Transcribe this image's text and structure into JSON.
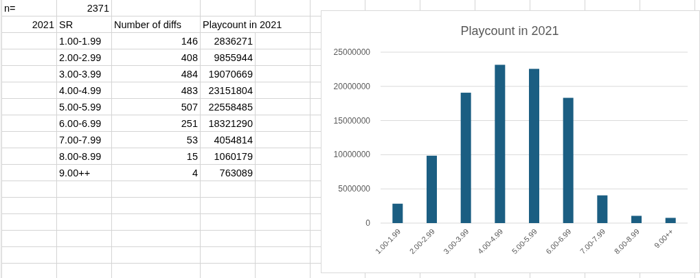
{
  "sheet": {
    "rows": [
      {
        "cells": [
          {
            "text": "n=",
            "kind": "text"
          },
          {
            "text": "2371",
            "kind": "number"
          }
        ]
      },
      {
        "cells": [
          {
            "text": "2021",
            "kind": "number"
          },
          {
            "text": "SR",
            "kind": "text"
          },
          {
            "text": "Number of diffs",
            "kind": "text"
          },
          {
            "text": "Playcount in 2021",
            "kind": "text"
          }
        ]
      },
      {
        "cells": [
          null,
          {
            "text": "1.00-1.99",
            "kind": "text"
          },
          {
            "text": "146",
            "kind": "number"
          },
          {
            "text": "2836271",
            "kind": "number"
          }
        ]
      },
      {
        "cells": [
          null,
          {
            "text": "2.00-2.99",
            "kind": "text"
          },
          {
            "text": "408",
            "kind": "number"
          },
          {
            "text": "9855944",
            "kind": "number"
          }
        ]
      },
      {
        "cells": [
          null,
          {
            "text": "3.00-3.99",
            "kind": "text"
          },
          {
            "text": "484",
            "kind": "number"
          },
          {
            "text": "19070669",
            "kind": "number"
          }
        ]
      },
      {
        "cells": [
          null,
          {
            "text": "4.00-4.99",
            "kind": "text"
          },
          {
            "text": "483",
            "kind": "number"
          },
          {
            "text": "23151804",
            "kind": "number"
          }
        ]
      },
      {
        "cells": [
          null,
          {
            "text": "5.00-5.99",
            "kind": "text"
          },
          {
            "text": "507",
            "kind": "number"
          },
          {
            "text": "22558485",
            "kind": "number"
          }
        ]
      },
      {
        "cells": [
          null,
          {
            "text": "6.00-6.99",
            "kind": "text"
          },
          {
            "text": "251",
            "kind": "number"
          },
          {
            "text": "18321290",
            "kind": "number"
          }
        ]
      },
      {
        "cells": [
          null,
          {
            "text": "7.00-7.99",
            "kind": "text"
          },
          {
            "text": "53",
            "kind": "number"
          },
          {
            "text": "4054814",
            "kind": "number"
          }
        ]
      },
      {
        "cells": [
          null,
          {
            "text": "8.00-8.99",
            "kind": "text"
          },
          {
            "text": "15",
            "kind": "number"
          },
          {
            "text": "1060179",
            "kind": "number"
          }
        ]
      },
      {
        "cells": [
          null,
          {
            "text": "9.00++",
            "kind": "text"
          },
          {
            "text": "4",
            "kind": "number"
          },
          {
            "text": "763089",
            "kind": "number"
          }
        ]
      }
    ]
  },
  "chart": {
    "chart_data": {
      "type": "bar",
      "title": "Playcount in 2021",
      "categories": [
        "1.00-1.99",
        "2.00-2.99",
        "3.00-3.99",
        "4.00-4.99",
        "5.00-5.99",
        "6.00-6.99",
        "7.00-7.99",
        "8.00-8.99",
        "9.00++"
      ],
      "series": [
        {
          "color": "#1b5e82",
          "values": [
            2836271,
            9855944,
            19070669,
            23151804,
            22558485,
            18321290,
            4054814,
            1060179,
            763089
          ]
        }
      ],
      "ylim": [
        0,
        25000000
      ],
      "grid": true,
      "yticks": [
        0,
        5000000,
        10000000,
        15000000,
        20000000,
        25000000
      ]
    }
  }
}
